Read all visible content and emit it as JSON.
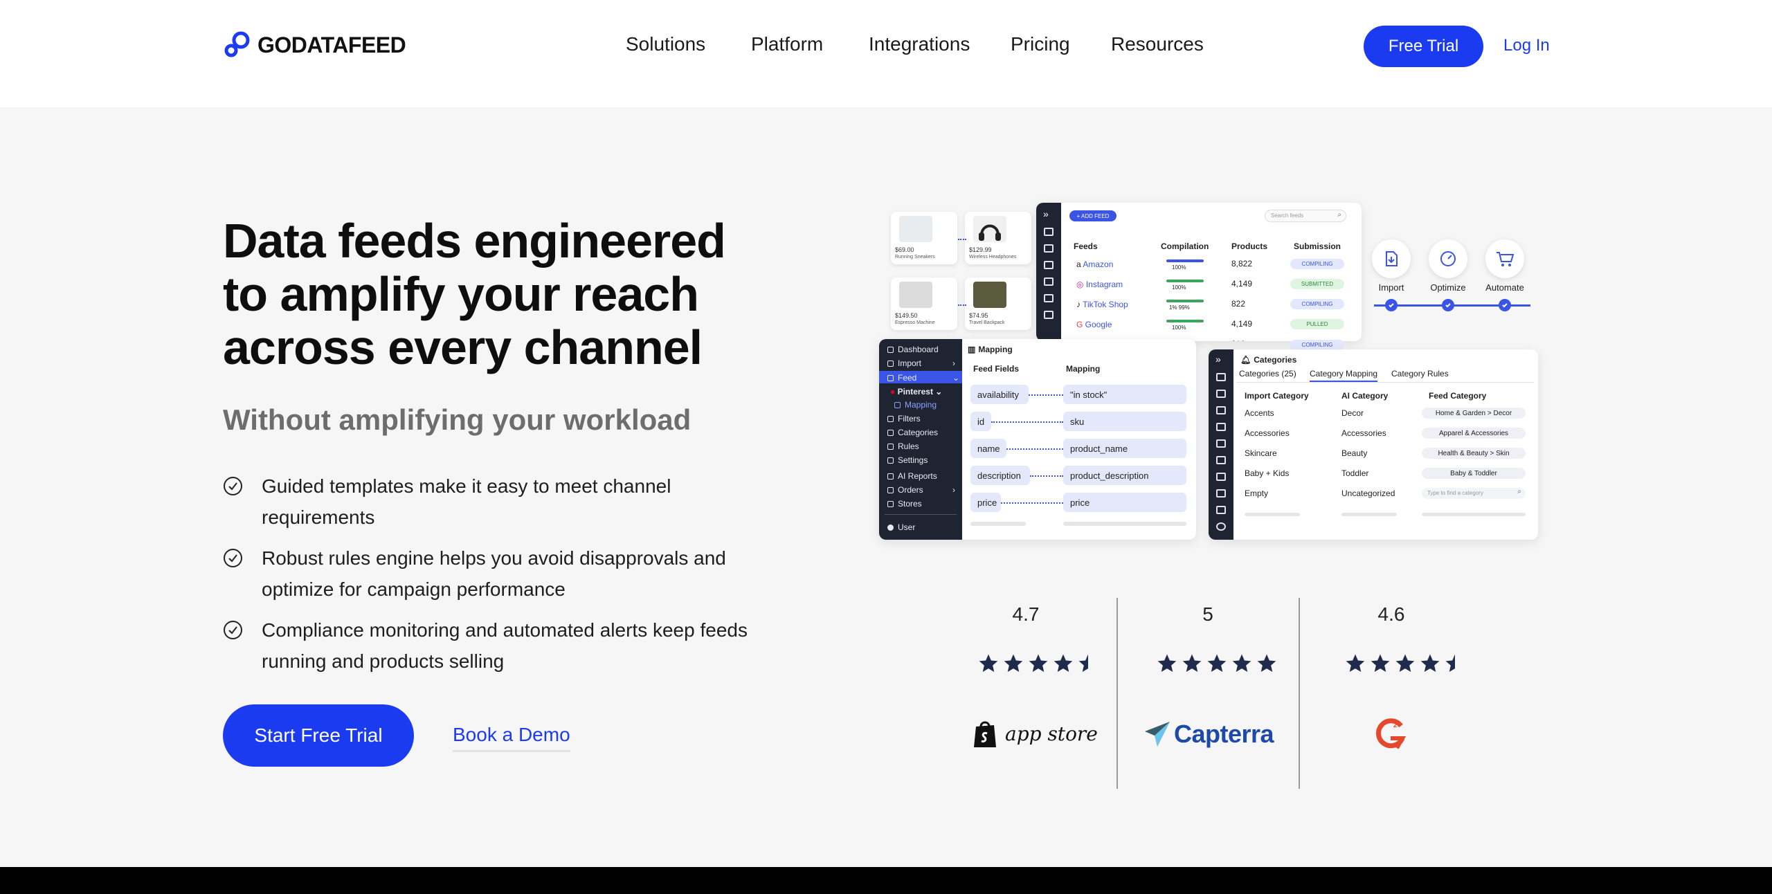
{
  "header": {
    "logo_text": "GODATAFEED",
    "nav": [
      "Solutions",
      "Platform",
      "Integrations",
      "Pricing",
      "Resources"
    ],
    "free_trial_label": "Free Trial",
    "login_label": "Log In"
  },
  "hero": {
    "title_lines": [
      "Data feeds engineered",
      "to amplify your reach",
      "across every channel"
    ],
    "subtitle": "Without amplifying your workload",
    "bullets": [
      "Guided templates make it easy to meet channel requirements",
      "Robust rules engine helps you avoid disapprovals and optimize for campaign performance",
      "Compliance monitoring and automated alerts keep feeds running and products selling"
    ],
    "start_trial_label": "Start Free Trial",
    "book_demo_label": "Book a Demo"
  },
  "mock": {
    "products": [
      {
        "price": "$69.00",
        "name": "Running Sneakers"
      },
      {
        "price": "$129.99",
        "name": "Wireless Headphones"
      },
      {
        "price": "$149.50",
        "name": "Espresso Machine"
      },
      {
        "price": "$74.95",
        "name": "Travel Backpack"
      }
    ],
    "feeds_panel": {
      "add_feed": "+ ADD FEED",
      "search_placeholder": "Search feeds",
      "headers": [
        "Feeds",
        "Compilation",
        "Products",
        "Submission"
      ],
      "rows": [
        {
          "feed": "Amazon",
          "compilation": "100%",
          "products": "8,822",
          "submission": "COMPILING",
          "status": "blue"
        },
        {
          "feed": "Instagram",
          "compilation": "100%",
          "products": "4,149",
          "submission": "SUBMITTED",
          "status": "green"
        },
        {
          "feed": "TikTok Shop",
          "compilation": "1%  99%",
          "products": "822",
          "submission": "COMPILING",
          "status": "blue"
        },
        {
          "feed": "Google",
          "compilation": "100%",
          "products": "4,149",
          "submission": "PULLED",
          "status": "green"
        },
        {
          "feed": "",
          "compilation": "",
          "products": "810",
          "submission": "COMPILING",
          "status": "blue"
        }
      ]
    },
    "steps": [
      "Import",
      "Optimize",
      "Automate"
    ],
    "sidebar": {
      "items": [
        "Dashboard",
        "Import",
        "Feed",
        "Pinterest",
        "Mapping",
        "Filters",
        "Categories",
        "Rules",
        "Settings",
        "AI Reports",
        "Orders",
        "Stores"
      ],
      "user": "User"
    },
    "mapping": {
      "title": "Mapping",
      "col_fields": "Feed Fields",
      "col_mapping": "Mapping",
      "rows": [
        {
          "field": "availability",
          "value": "\"in stock\""
        },
        {
          "field": "id",
          "value": "sku"
        },
        {
          "field": "name",
          "value": "product_name"
        },
        {
          "field": "description",
          "value": "product_description"
        },
        {
          "field": "price",
          "value": "price"
        }
      ]
    },
    "categories": {
      "title": "Categories",
      "tabs": [
        "Categories (25)",
        "Category Mapping",
        "Category Rules"
      ],
      "headers": [
        "Import Category",
        "AI Category",
        "Feed Category"
      ],
      "rows": [
        {
          "import": "Accents",
          "ai": "Decor",
          "feed": "Home & Garden > Decor"
        },
        {
          "import": "Accessories",
          "ai": "Accessories",
          "feed": "Apparel & Accessories"
        },
        {
          "import": "Skincare",
          "ai": "Beauty",
          "feed": "Health & Beauty > Skin"
        },
        {
          "import": "Baby + Kids",
          "ai": "Toddler",
          "feed": "Baby & Toddler"
        },
        {
          "import": "Empty",
          "ai": "Uncategorized",
          "feed": "Type to find a category"
        }
      ]
    }
  },
  "ratings": [
    {
      "score": "4.7",
      "stars": 4.5,
      "brand": "app store"
    },
    {
      "score": "5",
      "stars": 5,
      "brand": "Capterra"
    },
    {
      "score": "4.6",
      "stars": 4.5,
      "brand": "G2"
    }
  ],
  "colors": {
    "accent": "#1b3bf0",
    "star": "#1f2b4d",
    "capterra_blue": "#1d4aa8",
    "g2_red": "#e4492c"
  }
}
